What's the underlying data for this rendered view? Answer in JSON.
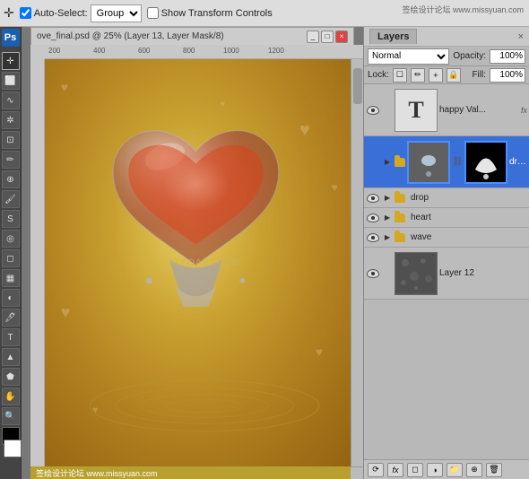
{
  "toolbar": {
    "move_tool_symbol": "✛",
    "auto_select_label": "Auto-Select:",
    "auto_select_value": "Group",
    "show_transform_label": "Show Transform Controls",
    "watermark_top": "签绘设计论坛 www.missyuan.com"
  },
  "canvas": {
    "title": "ove_final.psd @ 25% (Layer 13, Layer Mask/8)",
    "rulers": {
      "marks": [
        "200",
        "400",
        "600",
        "800",
        "1000",
        "1200"
      ]
    },
    "watermark_center": "ALFOART.COM",
    "watermark_bottom_left": "签绘设计论坛 www.missyuan.com",
    "watermark_bottom_right": ""
  },
  "layers_panel": {
    "title": "Layers",
    "close_btn": "×",
    "blend_mode": "Normal",
    "opacity_label": "Opacity:",
    "opacity_value": "100%",
    "lock_label": "Lock:",
    "lock_icons": [
      "☐",
      "✏",
      "+",
      "🔒"
    ],
    "fill_label": "Fill:",
    "fill_value": "100%",
    "layers": [
      {
        "id": "text-layer",
        "visible": true,
        "type": "text",
        "thumb_text": "T",
        "name": "happy Val...",
        "has_fx": true,
        "fx_label": "fx",
        "has_mask": false,
        "selected": false
      },
      {
        "id": "drops-group",
        "visible": false,
        "type": "group",
        "name": "drops",
        "has_fx": false,
        "has_thumb": true,
        "has_mask": true,
        "selected": true
      },
      {
        "id": "drop-group",
        "visible": true,
        "type": "group",
        "name": "drop",
        "has_fx": false,
        "has_thumb": false,
        "selected": false
      },
      {
        "id": "heart-group",
        "visible": true,
        "type": "group",
        "name": "heart",
        "has_fx": false,
        "has_thumb": false,
        "selected": false
      },
      {
        "id": "wave-group",
        "visible": true,
        "type": "group",
        "name": "wave",
        "has_fx": false,
        "has_thumb": false,
        "selected": false
      },
      {
        "id": "layer12",
        "visible": true,
        "type": "normal",
        "name": "Layer 12",
        "has_fx": false,
        "has_thumb": true,
        "has_mask": false,
        "selected": false
      }
    ],
    "bottom_buttons": [
      "⟳",
      "fx",
      "◻",
      "◻",
      "📁",
      "🗑"
    ]
  },
  "left_tools": [
    "▼",
    "✂",
    "⬡",
    "✏",
    "◢",
    "🖊",
    "S",
    "T",
    "A",
    "✋",
    "🔍",
    "🎨"
  ]
}
